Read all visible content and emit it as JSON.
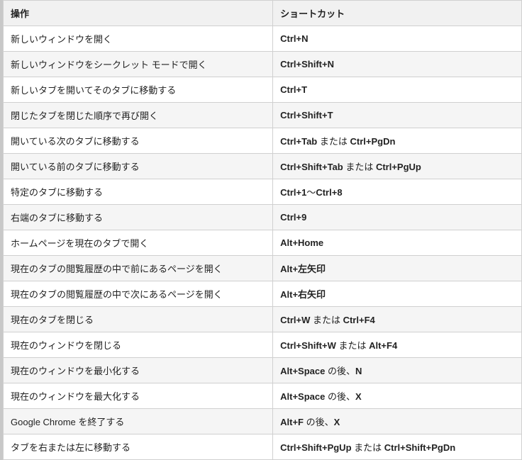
{
  "headers": {
    "action": "操作",
    "shortcut": "ショートカット"
  },
  "rows": [
    {
      "action": "新しいウィンドウを開く",
      "shortcut_parts": [
        {
          "b": "Ctrl+N"
        }
      ]
    },
    {
      "action": "新しいウィンドウをシークレット モードで開く",
      "shortcut_parts": [
        {
          "b": "Ctrl+Shift+N"
        }
      ]
    },
    {
      "action": "新しいタブを開いてそのタブに移動する",
      "shortcut_parts": [
        {
          "b": "Ctrl+T"
        }
      ]
    },
    {
      "action": "閉じたタブを閉じた順序で再び開く",
      "shortcut_parts": [
        {
          "b": "Ctrl+Shift+T"
        }
      ]
    },
    {
      "action": "開いている次のタブに移動する",
      "shortcut_parts": [
        {
          "b": "Ctrl+Tab"
        },
        {
          "t": " または "
        },
        {
          "b": "Ctrl+PgDn"
        }
      ]
    },
    {
      "action": "開いている前のタブに移動する",
      "shortcut_parts": [
        {
          "b": "Ctrl+Shift+Tab"
        },
        {
          "t": " または "
        },
        {
          "b": "Ctrl+PgUp"
        }
      ]
    },
    {
      "action": "特定のタブに移動する",
      "shortcut_parts": [
        {
          "b": "Ctrl+1"
        },
        {
          "t": "～"
        },
        {
          "b": "Ctrl+8"
        }
      ]
    },
    {
      "action": "右端のタブに移動する",
      "shortcut_parts": [
        {
          "b": "Ctrl+9"
        }
      ]
    },
    {
      "action": "ホームページを現在のタブで開く",
      "shortcut_parts": [
        {
          "b": "Alt+Home"
        }
      ]
    },
    {
      "action": "現在のタブの閲覧履歴の中で前にあるページを開く",
      "shortcut_parts": [
        {
          "b": "Alt+左矢印"
        }
      ]
    },
    {
      "action": "現在のタブの閲覧履歴の中で次にあるページを開く",
      "shortcut_parts": [
        {
          "b": "Alt+右矢印"
        }
      ]
    },
    {
      "action": "現在のタブを閉じる",
      "shortcut_parts": [
        {
          "b": "Ctrl+W"
        },
        {
          "t": " または "
        },
        {
          "b": "Ctrl+F4"
        }
      ]
    },
    {
      "action": "現在のウィンドウを閉じる",
      "shortcut_parts": [
        {
          "b": "Ctrl+Shift+W"
        },
        {
          "t": " または "
        },
        {
          "b": "Alt+F4"
        }
      ]
    },
    {
      "action": "現在のウィンドウを最小化する",
      "shortcut_parts": [
        {
          "b": "Alt+Space"
        },
        {
          "t": " の後、"
        },
        {
          "b": "N"
        }
      ]
    },
    {
      "action": "現在のウィンドウを最大化する",
      "shortcut_parts": [
        {
          "b": "Alt+Space"
        },
        {
          "t": " の後、"
        },
        {
          "b": "X"
        }
      ]
    },
    {
      "action": "Google Chrome を終了する",
      "shortcut_parts": [
        {
          "b": "Alt+F"
        },
        {
          "t": " の後、"
        },
        {
          "b": "X"
        }
      ]
    },
    {
      "action": "タブを右または左に移動する",
      "shortcut_parts": [
        {
          "b": "Ctrl+Shift+PgUp"
        },
        {
          "t": " または "
        },
        {
          "b": "Ctrl+Shift+PgDn"
        }
      ]
    }
  ]
}
